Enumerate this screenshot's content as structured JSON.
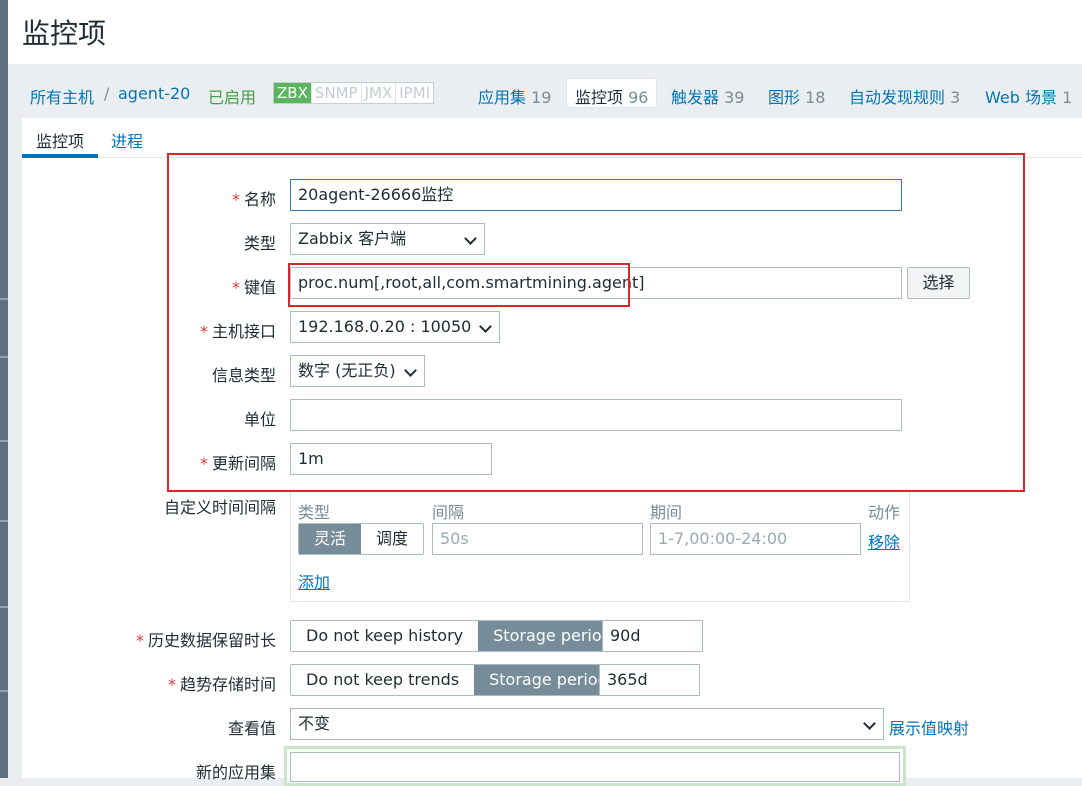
{
  "page": {
    "title": "监控项"
  },
  "host_nav": {
    "all_hosts": "所有主机",
    "separator": "/",
    "host": "agent-20",
    "status": "已启用",
    "availability": [
      "ZBX",
      "SNMP",
      "JMX",
      "IPMI"
    ],
    "availability_active": "ZBX",
    "items": [
      {
        "label": "应用集",
        "count": "19"
      },
      {
        "label": "监控项",
        "count": "96"
      },
      {
        "label": "触发器",
        "count": "39"
      },
      {
        "label": "图形",
        "count": "18"
      },
      {
        "label": "自动发现规则",
        "count": "3"
      },
      {
        "label": "Web 场景",
        "count": "1"
      }
    ]
  },
  "tabs": {
    "item": "监控项",
    "process": "进程"
  },
  "form": {
    "name": {
      "label": "名称",
      "value": "20agent-26666监控"
    },
    "type": {
      "label": "类型",
      "value": "Zabbix 客户端"
    },
    "key": {
      "label": "键值",
      "value": "proc.num[,root,all,com.smartmining.agent]",
      "select_button": "选择"
    },
    "interface": {
      "label": "主机接口",
      "value": "192.168.0.20 : 10050"
    },
    "info_type": {
      "label": "信息类型",
      "value": "数字 (无正负)"
    },
    "units": {
      "label": "单位",
      "value": ""
    },
    "interval": {
      "label": "更新间隔",
      "value": "1m"
    },
    "custom_intervals": {
      "label": "自定义时间间隔",
      "col_type": "类型",
      "col_interval": "间隔",
      "col_period": "期间",
      "col_action": "动作",
      "flexible": "灵活",
      "scheduling": "调度",
      "interval_placeholder": "50s",
      "period_placeholder": "1-7,00:00-24:00",
      "remove": "移除",
      "add": "添加"
    },
    "history": {
      "label": "历史数据保留时长",
      "no_keep": "Do not keep history",
      "storage": "Storage period",
      "value": "90d"
    },
    "trends": {
      "label": "趋势存储时间",
      "no_keep": "Do not keep trends",
      "storage": "Storage period",
      "value": "365d"
    },
    "valuemap": {
      "label": "查看值",
      "value": "不变",
      "link": "展示值映射"
    },
    "new_application": {
      "label": "新的应用集",
      "value": ""
    }
  },
  "colors": {
    "accent": "#0275b8",
    "annotation": "#d9262b",
    "required": "#e33734",
    "zbx": "#5bb55f"
  }
}
